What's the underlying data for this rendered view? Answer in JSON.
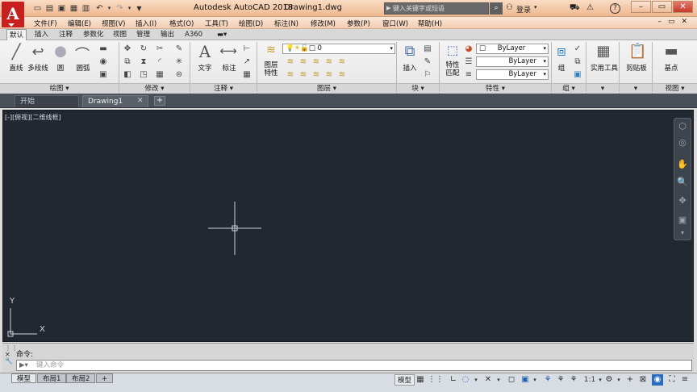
{
  "app": {
    "logo": "A",
    "title": "Autodesk AutoCAD 2018",
    "document": "Drawing1.dwg"
  },
  "quick_access": {
    "icons": [
      "new-file-icon",
      "open-folder-icon",
      "save-icon",
      "save-as-icon",
      "print-icon",
      "undo-icon",
      "redo-icon",
      "dropdown-icon"
    ]
  },
  "search": {
    "placeholder": "键入关键字或短语"
  },
  "account": {
    "login_label": "登录"
  },
  "menus": [
    "文件(F)",
    "编辑(E)",
    "视图(V)",
    "插入(I)",
    "格式(O)",
    "工具(T)",
    "绘图(D)",
    "标注(N)",
    "修改(M)",
    "参数(P)",
    "窗口(W)",
    "帮助(H)"
  ],
  "ribbon_tabs": [
    "默认",
    "插入",
    "注释",
    "参数化",
    "视图",
    "管理",
    "输出",
    "A360"
  ],
  "panels": {
    "draw": {
      "title": "绘图",
      "tools": [
        "直线",
        "多段线",
        "圆",
        "圆弧"
      ]
    },
    "modify": {
      "title": "修改"
    },
    "annotation": {
      "title": "注释",
      "tools": [
        "文字",
        "标注"
      ]
    },
    "layers": {
      "title": "图层",
      "tool": "图层\n特性",
      "layer_tool_line1": "图层",
      "layer_tool_line2": "特性",
      "current_layer": "0"
    },
    "block": {
      "title": "块",
      "tool": "插入"
    },
    "properties": {
      "title": "特性",
      "match_line1": "特性",
      "match_line2": "匹配",
      "color": "ByLayer",
      "linetype": "ByLayer",
      "lineweight": "ByLayer"
    },
    "groups": {
      "title": "组",
      "tool": "组"
    },
    "utilities": {
      "tool": "实用工具"
    },
    "clipboard": {
      "tool": "剪贴板"
    },
    "view": {
      "title": "视图",
      "tool": "基点"
    }
  },
  "doc_tabs": [
    "开始",
    "Drawing1"
  ],
  "viewport_label": "[-][俯视][二维线框]",
  "ucs": {
    "x": "X",
    "y": "Y"
  },
  "command": {
    "history": "命令:",
    "placeholder": "键入命令"
  },
  "layout_tabs": [
    "模型",
    "布局1",
    "布局2"
  ],
  "status": {
    "model": "模型",
    "scale": "1:1"
  },
  "colors": {
    "canvas": "#212830",
    "title_gradient": "#efb890",
    "logo": "#c8201e"
  }
}
